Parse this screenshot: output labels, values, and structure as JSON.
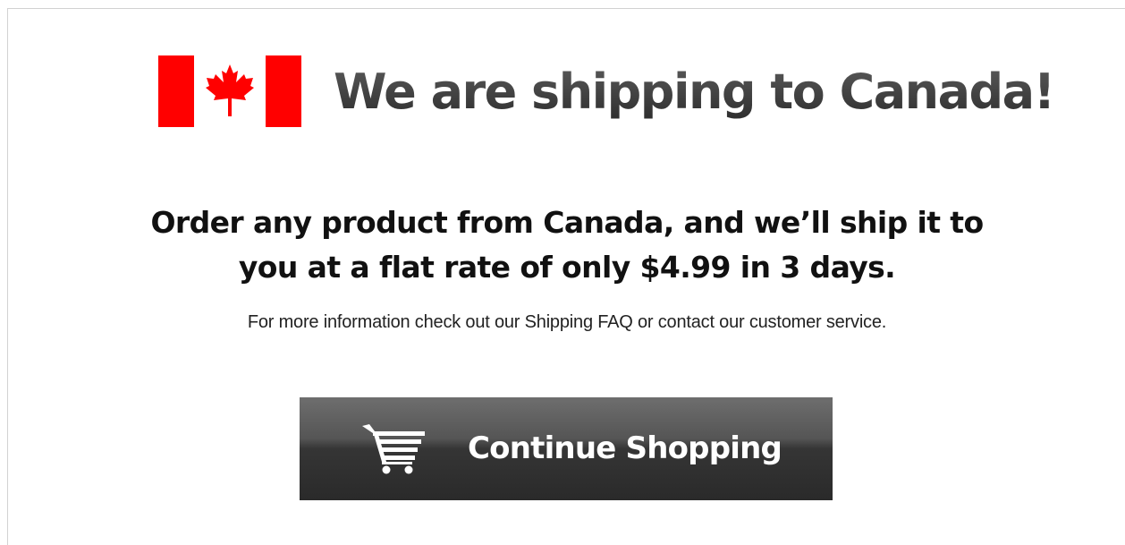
{
  "header": {
    "title": "We are shipping to Canada!",
    "flag_icon": "canada-flag-icon",
    "flag_colors": {
      "red": "#ff0000",
      "white": "#ffffff"
    }
  },
  "message": {
    "line1": "Order any product from Canada, and we’ll ship it to",
    "line2": "you at a flat rate of only $4.99 in 3 days.",
    "info": "For more information check out our Shipping FAQ or contact our customer service."
  },
  "cta": {
    "label": "Continue Shopping",
    "icon": "shopping-cart-icon"
  }
}
